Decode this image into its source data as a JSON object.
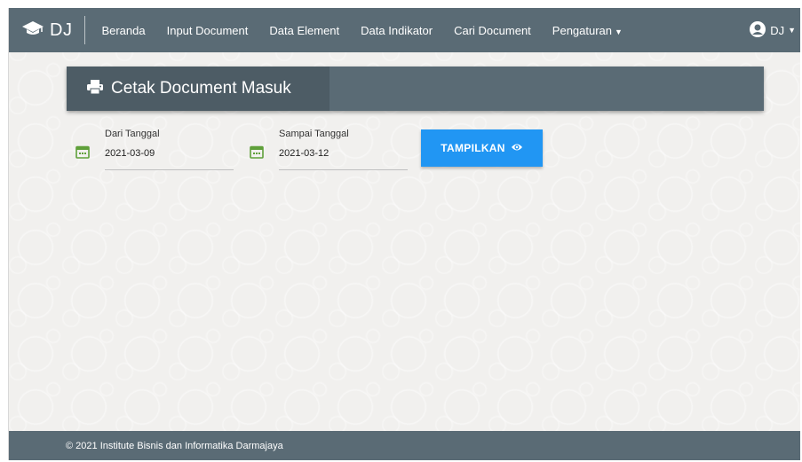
{
  "navbar": {
    "brand": "DJ",
    "items": [
      {
        "label": "Beranda"
      },
      {
        "label": "Input Document"
      },
      {
        "label": "Data Element"
      },
      {
        "label": "Data Indikator"
      },
      {
        "label": "Cari Document"
      },
      {
        "label": "Pengaturan"
      }
    ],
    "user": "DJ"
  },
  "card": {
    "title": "Cetak Document Masuk"
  },
  "form": {
    "from_label": "Dari Tanggal",
    "from_value": "2021-03-09",
    "to_label": "Sampai Tanggal",
    "to_value": "2021-03-12",
    "button_label": "TAMPILKAN"
  },
  "footer": {
    "text": "© 2021 Institute Bisnis dan Informatika Darmajaya"
  },
  "colors": {
    "navbar": "#5a6b75",
    "title_box": "#4d5c65",
    "button": "#2196f3",
    "calendar_icon": "#5fa03a",
    "background": "#f1f0ee"
  }
}
